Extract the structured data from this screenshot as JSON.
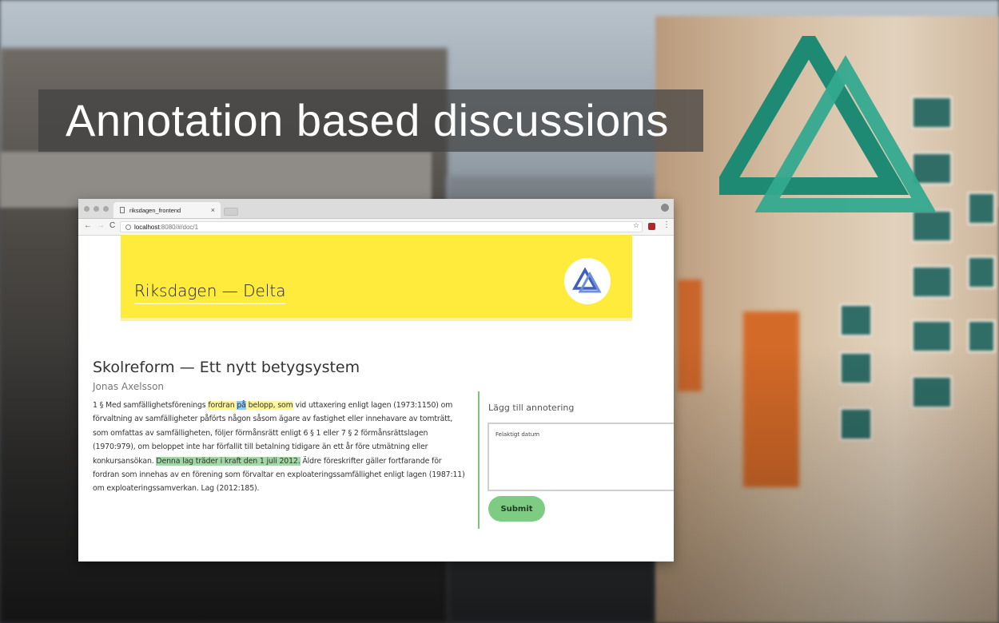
{
  "slide": {
    "title": "Annotation based discussions"
  },
  "browser": {
    "tab_title": "riksdagen_frontend",
    "tab_close": "×",
    "url_host": "localhost",
    "url_path": ":8080/#/doc/1",
    "nav_back": "←",
    "nav_forward": "→",
    "nav_reload": "C",
    "star": "☆",
    "menu": "⋮"
  },
  "page": {
    "hero_title": "Riksdagen — Delta",
    "doc_title": "Skolreform — Ett nytt betygsystem",
    "doc_author": "Jonas Axelsson",
    "body": {
      "p1": "1 § Med samfällighetsförenings ",
      "hl1": "fordran ",
      "hl2": "på",
      "hl3": " belopp, som",
      "p2": " vid uttaxering enligt lagen (1973:1150) om förvaltning av samfälligheter påförts någon såsom ägare av fastighet eller innehavare av tomträtt, som omfattas av samfälligheten, följer förmånsrätt enligt 6 § 1 eller 7 § 2 förmånsrättslagen (1970:979), om beloppet inte har förfallit till betalning tidigare än ett år före utmätning eller konkursansökan. ",
      "hl4": "Denna lag träder i kraft den 1 juli 2012.",
      "p3": " Äldre föreskrifter gäller fortfarande för fordran som innehas av en förening som förvaltar en exploateringssamfällighet enligt lagen (1987:11) om exploateringssamverkan. Lag (2012:185)."
    },
    "annotation": {
      "heading": "Lägg till annotering",
      "value": "Felaktigt datum",
      "submit_label": "Submit"
    }
  },
  "colors": {
    "accent_teal": "#1e8a74",
    "accent_teal_light": "#33a98f",
    "hero_yellow": "#ffeb3b",
    "submit_green": "#7ecb83",
    "logo_blue": "#3f5fbf"
  }
}
